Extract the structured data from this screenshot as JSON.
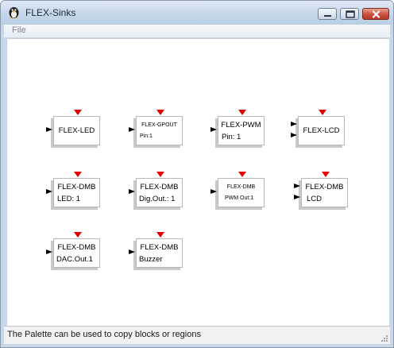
{
  "window": {
    "title": "FLEX-Sinks",
    "icon": "scilab-penguin-icon",
    "buttons": [
      "minimize-icon",
      "maximize-icon",
      "close-icon"
    ]
  },
  "menu": {
    "items": [
      "File"
    ]
  },
  "palette": {
    "blocks": [
      {
        "id": "flex-led",
        "lines": [
          "FLEX-LED"
        ],
        "inputs": 1
      },
      {
        "id": "flex-gpout",
        "lines": [
          "FLEX-GPOUT",
          "Pin:1"
        ],
        "inputs": 1
      },
      {
        "id": "flex-pwm",
        "lines": [
          "FLEX-PWM",
          "Pin: 1"
        ],
        "inputs": 1
      },
      {
        "id": "flex-lcd",
        "lines": [
          "FLEX-LCD"
        ],
        "inputs": 2
      },
      {
        "id": "flex-dmb-led",
        "lines": [
          "FLEX-DMB",
          "LED: 1"
        ],
        "inputs": 1
      },
      {
        "id": "flex-dmb-digout",
        "lines": [
          "FLEX-DMB",
          "Dig.Out.: 1"
        ],
        "inputs": 1
      },
      {
        "id": "flex-dmb-pwmout",
        "lines": [
          "FLEX-DMB",
          "PWM Out:1"
        ],
        "inputs": 1
      },
      {
        "id": "flex-dmb-lcd",
        "lines": [
          "FLEX-DMB",
          "LCD"
        ],
        "inputs": 2
      },
      {
        "id": "flex-dmb-dacout",
        "lines": [
          "FLEX-DMB",
          "DAC.Out.1"
        ],
        "inputs": 1
      },
      {
        "id": "flex-dmb-buzzer",
        "lines": [
          "FLEX-DMB",
          "Buzzer"
        ],
        "inputs": 1
      }
    ]
  },
  "status": {
    "text": "The Palette can be used to copy blocks or regions"
  },
  "colors": {
    "trigger": "#e30000",
    "titlebar": "#c8d8ec"
  }
}
